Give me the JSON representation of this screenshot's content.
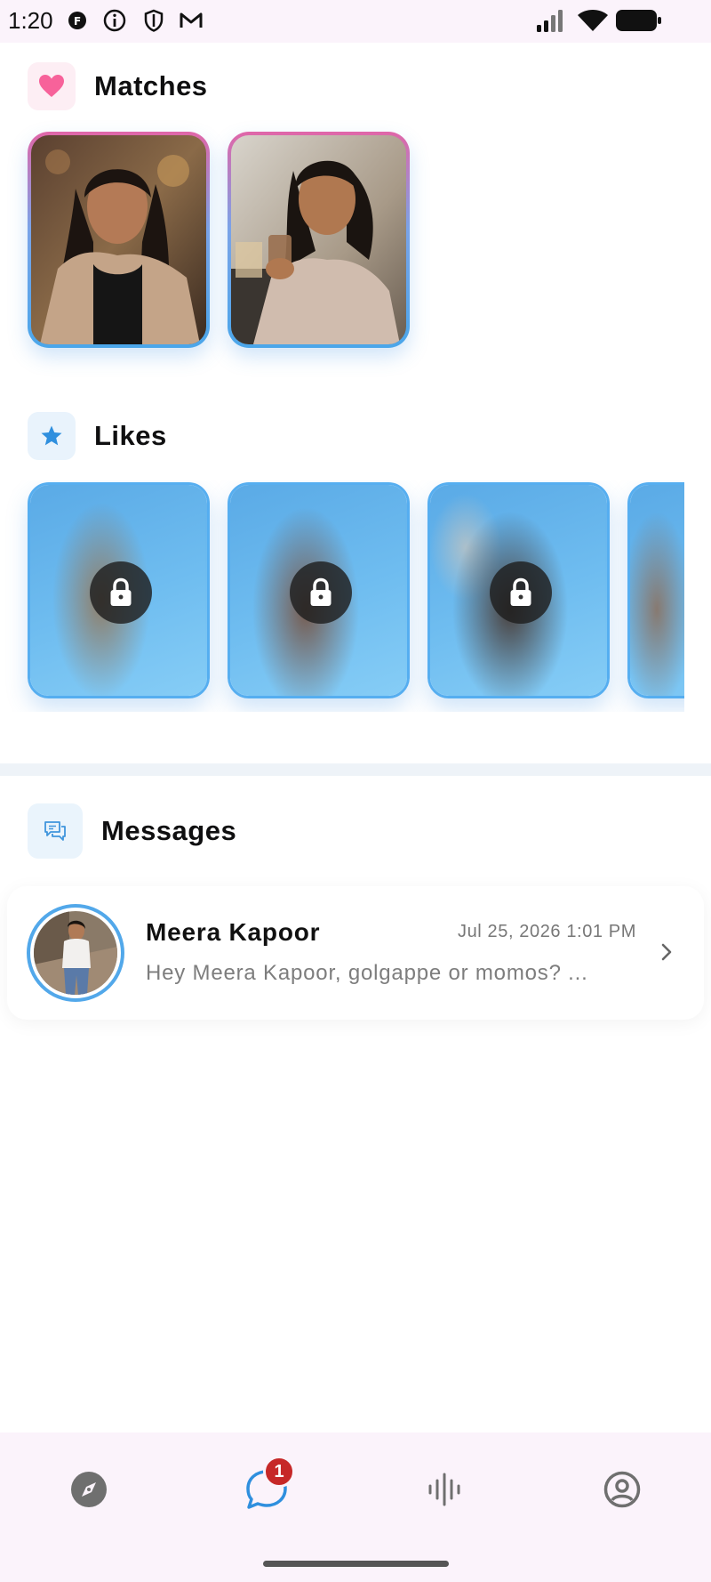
{
  "status_bar": {
    "time": "1:20",
    "icons": [
      "app-icon",
      "info-icon",
      "shield-icon",
      "gmail-icon"
    ],
    "right_icons": [
      "signal-icon",
      "wifi-icon",
      "battery-icon"
    ]
  },
  "matches": {
    "title": "Matches",
    "icon": "heart-icon",
    "cards": [
      {
        "name": "match-1"
      },
      {
        "name": "match-2"
      }
    ]
  },
  "likes": {
    "title": "Likes",
    "icon": "star-icon",
    "cards": 4
  },
  "messages": {
    "title": "Messages",
    "icon": "chat-icon",
    "items": [
      {
        "name": "Meera Kapoor",
        "time": "Jul 25, 2026 1:01 PM",
        "preview": "Hey Meera Kapoor, golgappe or momos? ..."
      }
    ]
  },
  "bottom_nav": {
    "items": [
      "compass-icon",
      "chat-icon",
      "voice-icon",
      "profile-icon"
    ],
    "chat_badge": "1"
  },
  "colors": {
    "accent_blue": "#4aa6ea",
    "accent_pink": "#ff6fa8",
    "badge_red": "#c62828"
  }
}
